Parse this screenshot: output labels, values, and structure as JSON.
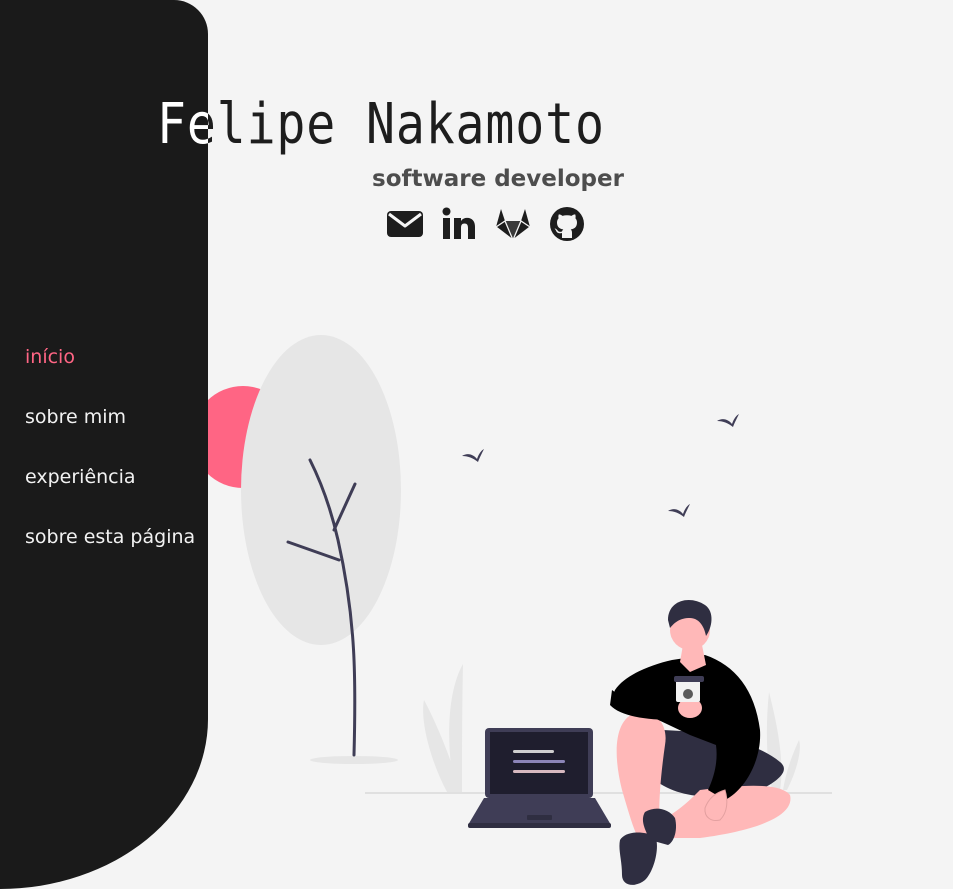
{
  "header": {
    "name": "Felipe Nakamoto",
    "subtitle": "software developer"
  },
  "social": [
    {
      "icon": "envelope-icon"
    },
    {
      "icon": "linkedin-icon"
    },
    {
      "icon": "gitlab-icon"
    },
    {
      "icon": "github-icon"
    }
  ],
  "nav": {
    "items": [
      {
        "label": "início",
        "active": true
      },
      {
        "label": "sobre mim"
      },
      {
        "label": "experiência"
      },
      {
        "label": "sobre esta página"
      }
    ]
  },
  "colors": {
    "accent": "#ff6584",
    "sidebar": "#1a1a1a",
    "background": "#f4f4f4",
    "dark_purple": "#3f3d56"
  }
}
